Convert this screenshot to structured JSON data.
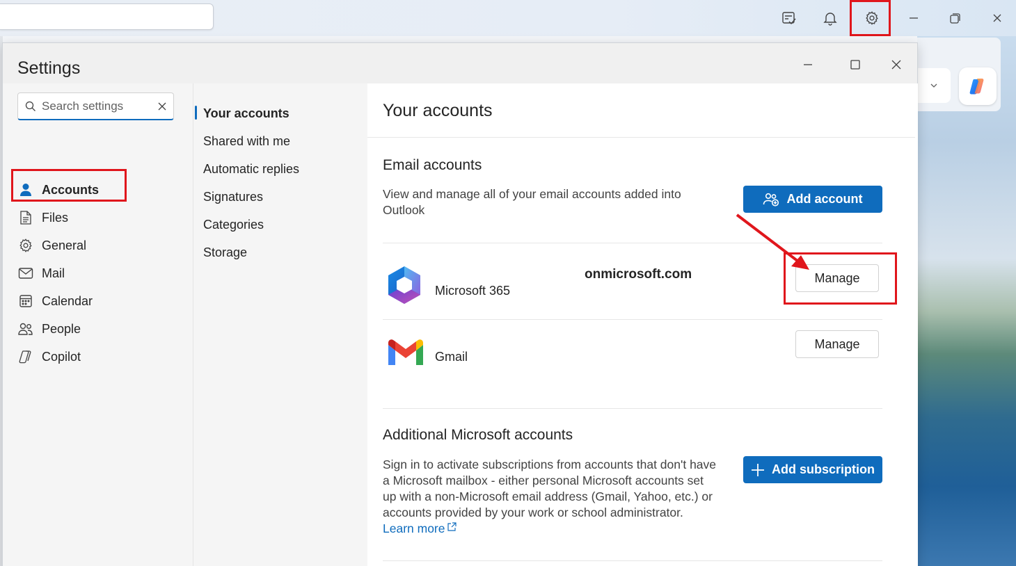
{
  "app": {
    "top_search": {
      "value": ""
    }
  },
  "dialog": {
    "settings_title": "Settings",
    "search": {
      "placeholder": "Search settings"
    },
    "nav": [
      {
        "label": "Accounts",
        "icon": "person-icon",
        "active": true
      },
      {
        "label": "Files",
        "icon": "file-icon",
        "active": false
      },
      {
        "label": "General",
        "icon": "gear-icon",
        "active": false
      },
      {
        "label": "Mail",
        "icon": "mail-icon",
        "active": false
      },
      {
        "label": "Calendar",
        "icon": "calendar-icon",
        "active": false
      },
      {
        "label": "People",
        "icon": "people-icon",
        "active": false
      },
      {
        "label": "Copilot",
        "icon": "copilot-icon",
        "active": false
      }
    ],
    "subnav": [
      {
        "label": "Your accounts",
        "active": true
      },
      {
        "label": "Shared with me",
        "active": false
      },
      {
        "label": "Automatic replies",
        "active": false
      },
      {
        "label": "Signatures",
        "active": false
      },
      {
        "label": "Categories",
        "active": false
      },
      {
        "label": "Storage",
        "active": false
      }
    ]
  },
  "content": {
    "title": "Your accounts",
    "email_section": {
      "heading": "Email accounts",
      "description": "View and manage all of your email accounts added into Outlook",
      "add_button": "Add account"
    },
    "accounts": [
      {
        "name": "Microsoft 365",
        "email": "onmicrosoft.com",
        "manage_label": "Manage",
        "logo": "microsoft365-logo"
      },
      {
        "name": "Gmail",
        "email": "",
        "manage_label": "Manage",
        "logo": "gmail-logo"
      }
    ],
    "additional_section": {
      "heading": "Additional Microsoft accounts",
      "description": "Sign in to activate subscriptions from accounts that don't have a Microsoft mailbox - either personal Microsoft accounts set up with a non-Microsoft email address (Gmail, Yahoo, etc.) or accounts provided by your work or school administrator.",
      "link": "Learn more",
      "add_button": "Add subscription"
    }
  },
  "colors": {
    "accent": "#0f6cbd",
    "highlight": "#e0161c"
  }
}
